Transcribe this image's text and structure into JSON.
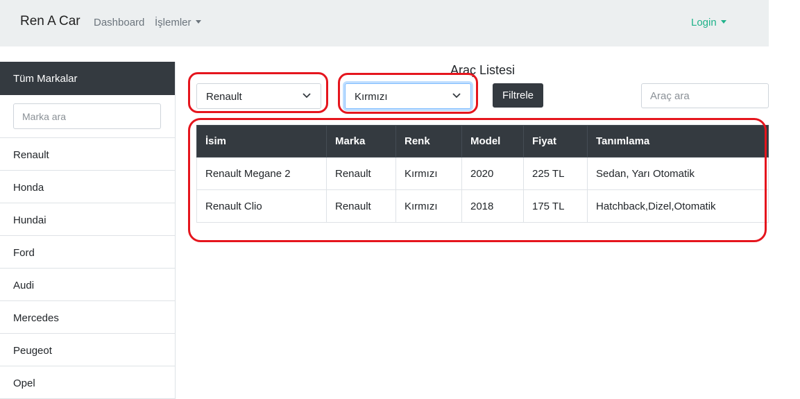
{
  "navbar": {
    "brand": "Ren A Car",
    "links": [
      "Dashboard",
      "İşlemler"
    ],
    "login": "Login"
  },
  "sidebar": {
    "header": "Tüm Markalar",
    "search_placeholder": "Marka ara",
    "brands": [
      "Renault",
      "Honda",
      "Hundai",
      "Ford",
      "Audi",
      "Mercedes",
      "Peugeot",
      "Opel"
    ]
  },
  "main": {
    "title": "Araç Listesi",
    "brand_select": "Renault",
    "color_select": "Kırmızı",
    "filter_button": "Filtrele",
    "search_placeholder": "Araç ara",
    "table": {
      "headers": [
        "İsim",
        "Marka",
        "Renk",
        "Model",
        "Fiyat",
        "Tanımlama"
      ],
      "rows": [
        [
          "Renault Megane 2",
          "Renault",
          "Kırmızı",
          "2020",
          "225 TL",
          "Sedan, Yarı Otomatik"
        ],
        [
          "Renault Clio",
          "Renault",
          "Kırmızı",
          "2018",
          "175 TL",
          "Hatchback,Dizel,Otomatik"
        ]
      ]
    }
  },
  "colors": {
    "dark": "#343a40",
    "navbar_bg": "#eceff0",
    "login": "#20b28a",
    "annotation": "#e5151d"
  }
}
